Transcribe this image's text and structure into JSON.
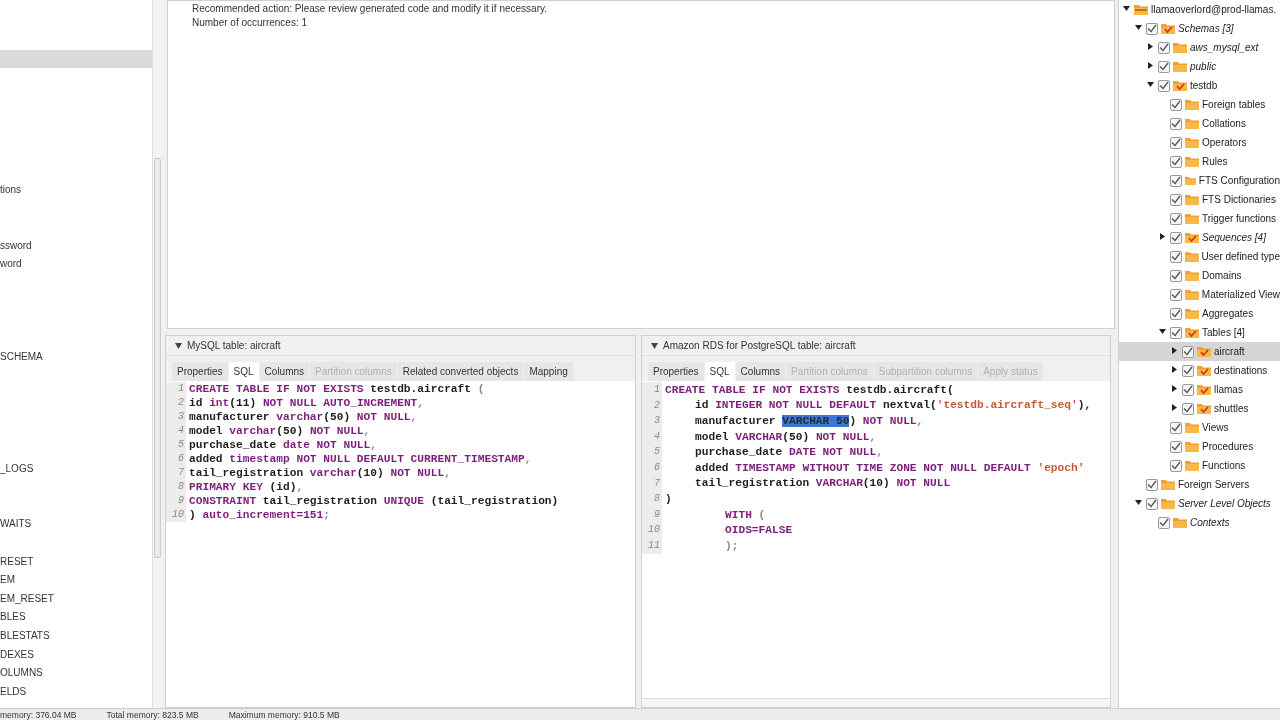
{
  "left_panel": {
    "items": [
      {
        "label": "tions"
      },
      {
        "label": "ssword"
      },
      {
        "label": "word"
      },
      {
        "label": "SCHEMA"
      },
      {
        "label": "_LOGS"
      },
      {
        "label": "WAITS"
      },
      {
        "label": "RESET"
      },
      {
        "label": "EM"
      },
      {
        "label": "EM_RESET"
      },
      {
        "label": "BLES"
      },
      {
        "label": "BLESTATS"
      },
      {
        "label": "DEXES"
      },
      {
        "label": "OLUMNS"
      },
      {
        "label": "ELDS"
      }
    ]
  },
  "message": {
    "lines": [
      "Recommended action: Please review generated code and modify it if necessary.",
      "Number of occurrences: 1"
    ]
  },
  "panels": [
    {
      "title": "MySQL table: aircraft",
      "expanded": true,
      "tabs": [
        {
          "label": "Properties",
          "selected": false,
          "disabled": false
        },
        {
          "label": "SQL",
          "selected": true,
          "disabled": false
        },
        {
          "label": "Columns",
          "selected": false,
          "disabled": false
        },
        {
          "label": "Partition columns",
          "selected": false,
          "disabled": true
        },
        {
          "label": "Related converted objects",
          "selected": false,
          "disabled": false
        },
        {
          "label": "Mapping",
          "selected": false,
          "disabled": false
        }
      ],
      "code": [
        {
          "number": "1",
          "kind": "top",
          "tokens": [
            {
              "text": "CREATE TABLE IF NOT EXISTS ",
              "kind": "keyword"
            },
            {
              "text": "testdb.aircraft ",
              "kind": "name"
            },
            {
              "text": "(",
              "kind": "punct"
            }
          ]
        },
        {
          "number": "2",
          "kind": "top",
          "tokens": [
            {
              "text": "id ",
              "kind": "name"
            },
            {
              "text": "int",
              "kind": "keyword"
            },
            {
              "text": "(11) ",
              "kind": "name"
            },
            {
              "text": "NOT NULL AUTO_INCREMENT",
              "kind": "keyword"
            },
            {
              "text": ",",
              "kind": "punct"
            }
          ]
        },
        {
          "number": "3",
          "kind": "top",
          "tokens": [
            {
              "text": "manufacturer ",
              "kind": "name"
            },
            {
              "text": "varchar",
              "kind": "keyword"
            },
            {
              "text": "(50) ",
              "kind": "name"
            },
            {
              "text": "NOT NULL",
              "kind": "keyword"
            },
            {
              "text": ",",
              "kind": "punct"
            }
          ]
        },
        {
          "number": "4",
          "kind": "top",
          "tokens": [
            {
              "text": "model ",
              "kind": "name"
            },
            {
              "text": "varchar",
              "kind": "keyword"
            },
            {
              "text": "(50) ",
              "kind": "name"
            },
            {
              "text": "NOT NULL",
              "kind": "keyword"
            },
            {
              "text": ",",
              "kind": "punct"
            }
          ]
        },
        {
          "number": "5",
          "kind": "top",
          "tokens": [
            {
              "text": "purchase_date ",
              "kind": "name"
            },
            {
              "text": "date NOT NULL",
              "kind": "keyword"
            },
            {
              "text": ",",
              "kind": "punct"
            }
          ]
        },
        {
          "number": "6",
          "kind": "top",
          "tokens": [
            {
              "text": "added ",
              "kind": "name"
            },
            {
              "text": "timestamp NOT NULL DEFAULT CURRENT_TIMESTAMP",
              "kind": "keyword"
            },
            {
              "text": ",",
              "kind": "punct"
            }
          ]
        },
        {
          "number": "7",
          "kind": "top",
          "tokens": [
            {
              "text": "tail_registration ",
              "kind": "name"
            },
            {
              "text": "varchar",
              "kind": "keyword"
            },
            {
              "text": "(10) ",
              "kind": "name"
            },
            {
              "text": "NOT NULL",
              "kind": "keyword"
            },
            {
              "text": ",",
              "kind": "punct"
            }
          ]
        },
        {
          "number": "8",
          "kind": "top",
          "tokens": [
            {
              "text": "PRIMARY KEY ",
              "kind": "keyword"
            },
            {
              "text": "(id)",
              "kind": "name"
            },
            {
              "text": ",",
              "kind": "punct"
            }
          ]
        },
        {
          "number": "9",
          "kind": "top",
          "tokens": [
            {
              "text": "CONSTRAINT ",
              "kind": "keyword"
            },
            {
              "text": "tail_registration ",
              "kind": "name"
            },
            {
              "text": "UNIQUE ",
              "kind": "keyword"
            },
            {
              "text": "(tail_registration)",
              "kind": "name"
            }
          ]
        },
        {
          "number": "10",
          "kind": "top",
          "tokens": [
            {
              "text": ") ",
              "kind": "name"
            },
            {
              "text": "auto_increment=151",
              "kind": "keyword"
            },
            {
              "text": ";",
              "kind": "punct"
            }
          ]
        }
      ]
    },
    {
      "title": "Amazon RDS for PostgreSQL table: aircraft",
      "expanded": true,
      "tabs": [
        {
          "label": "Properties",
          "selected": false,
          "disabled": false
        },
        {
          "label": "SQL",
          "selected": true,
          "disabled": false
        },
        {
          "label": "Columns",
          "selected": false,
          "disabled": false
        },
        {
          "label": "Partition columns",
          "selected": false,
          "disabled": true
        },
        {
          "label": "Subpartition columns",
          "selected": false,
          "disabled": true
        },
        {
          "label": "Apply status",
          "selected": false,
          "disabled": true
        }
      ],
      "code": [
        {
          "number": "1",
          "kind": "top",
          "tokens": [
            {
              "text": "CREATE TABLE IF NOT EXISTS ",
              "kind": "keyword"
            },
            {
              "text": "testdb.aircraft(",
              "kind": "name"
            }
          ]
        },
        {
          "number": "2",
          "kind": "body",
          "tokens": [
            {
              "text": "id ",
              "kind": "name"
            },
            {
              "text": "INTEGER NOT NULL DEFAULT ",
              "kind": "keyword"
            },
            {
              "text": "nextval(",
              "kind": "name"
            },
            {
              "text": "'testdb.aircraft_seq'",
              "kind": "string"
            },
            {
              "text": "),",
              "kind": "name"
            }
          ]
        },
        {
          "number": "3",
          "kind": "body",
          "tokens": [
            {
              "text": "manufacturer ",
              "kind": "name"
            },
            {
              "text": "VARCHAR 50",
              "kind": "selection"
            },
            {
              "text": ") ",
              "kind": "name"
            },
            {
              "text": "NOT NULL",
              "kind": "keyword"
            },
            {
              "text": ",",
              "kind": "punct"
            }
          ]
        },
        {
          "number": "4",
          "kind": "body",
          "tokens": [
            {
              "text": "model ",
              "kind": "name"
            },
            {
              "text": "VARCHAR",
              "kind": "keyword"
            },
            {
              "text": "(50) ",
              "kind": "name"
            },
            {
              "text": "NOT NULL",
              "kind": "keyword"
            },
            {
              "text": ",",
              "kind": "punct"
            }
          ]
        },
        {
          "number": "5",
          "kind": "body",
          "tokens": [
            {
              "text": "purchase_date ",
              "kind": "name"
            },
            {
              "text": "DATE NOT NULL",
              "kind": "keyword"
            },
            {
              "text": ",",
              "kind": "punct"
            }
          ]
        },
        {
          "number": "6",
          "kind": "body",
          "tokens": [
            {
              "text": "added ",
              "kind": "name"
            },
            {
              "text": "TIMESTAMP WITHOUT TIME ZONE NOT NULL DEFAULT ",
              "kind": "keyword"
            },
            {
              "text": "'epoch'",
              "kind": "string"
            }
          ]
        },
        {
          "number": "7",
          "kind": "body",
          "tokens": [
            {
              "text": "tail_registration ",
              "kind": "name"
            },
            {
              "text": "VARCHAR",
              "kind": "keyword"
            },
            {
              "text": "(10) ",
              "kind": "name"
            },
            {
              "text": "NOT NULL",
              "kind": "keyword"
            }
          ]
        },
        {
          "number": "8",
          "kind": "top",
          "tokens": [
            {
              "text": ")",
              "kind": "name"
            }
          ]
        },
        {
          "number": "9",
          "kind": "clause",
          "tokens": [
            {
              "text": "WITH ",
              "kind": "keyword"
            },
            {
              "text": "(",
              "kind": "punct"
            }
          ]
        },
        {
          "number": "10",
          "kind": "clause",
          "tokens": [
            {
              "text": "OIDS=FALSE",
              "kind": "keyword"
            }
          ]
        },
        {
          "number": "11",
          "kind": "clause",
          "tokens": [
            {
              "text": ");",
              "kind": "punct"
            }
          ]
        }
      ]
    }
  ],
  "tree": {
    "root": {
      "label": "llamaoverlord@prod-llamas.",
      "kind": "server",
      "italic": false,
      "selected": false,
      "expanded": true,
      "children": [
        {
          "label": "Schemas [3]",
          "kind": "converted",
          "italic": true,
          "checked": true,
          "selected": false,
          "expanded": true,
          "children": [
            {
              "label": "aws_mysql_ext",
              "kind": "folder",
              "italic": true,
              "checked": true,
              "selected": false,
              "expanded": false
            },
            {
              "label": "public",
              "kind": "folder",
              "italic": true,
              "checked": true,
              "selected": false,
              "expanded": false
            },
            {
              "label": "testdb",
              "kind": "converted",
              "italic": false,
              "checked": true,
              "selected": false,
              "expanded": true,
              "children": [
                {
                  "label": "Foreign tables",
                  "kind": "folder",
                  "italic": false,
                  "checked": true,
                  "selected": false
                },
                {
                  "label": "Collations",
                  "kind": "folder",
                  "italic": false,
                  "checked": true,
                  "selected": false
                },
                {
                  "label": "Operators",
                  "kind": "folder",
                  "italic": false,
                  "checked": true,
                  "selected": false
                },
                {
                  "label": "Rules",
                  "kind": "folder",
                  "italic": false,
                  "checked": true,
                  "selected": false
                },
                {
                  "label": "FTS Configuration",
                  "kind": "folder",
                  "italic": false,
                  "checked": true,
                  "selected": false
                },
                {
                  "label": "FTS Dictionaries",
                  "kind": "folder",
                  "italic": false,
                  "checked": true,
                  "selected": false
                },
                {
                  "label": "Trigger functions",
                  "kind": "folder",
                  "italic": false,
                  "checked": true,
                  "selected": false
                },
                {
                  "label": "Sequences [4]",
                  "kind": "converted",
                  "italic": true,
                  "checked": true,
                  "selected": false,
                  "expanded": false
                },
                {
                  "label": "User defined type",
                  "kind": "folder",
                  "italic": false,
                  "checked": true,
                  "selected": false
                },
                {
                  "label": "Domains",
                  "kind": "folder",
                  "italic": false,
                  "checked": true,
                  "selected": false
                },
                {
                  "label": "Materialized View",
                  "kind": "folder",
                  "italic": false,
                  "checked": true,
                  "selected": false
                },
                {
                  "label": "Aggregates",
                  "kind": "folder",
                  "italic": false,
                  "checked": true,
                  "selected": false
                },
                {
                  "label": "Tables [4]",
                  "kind": "converted",
                  "italic": false,
                  "checked": true,
                  "selected": false,
                  "expanded": true,
                  "children": [
                    {
                      "label": "aircraft",
                      "kind": "converted",
                      "italic": false,
                      "checked": true,
                      "selected": true,
                      "expanded": false
                    },
                    {
                      "label": "destinations",
                      "kind": "converted",
                      "italic": false,
                      "checked": true,
                      "selected": false,
                      "expanded": false
                    },
                    {
                      "label": "llamas",
                      "kind": "converted",
                      "italic": false,
                      "checked": true,
                      "selected": false,
                      "expanded": false
                    },
                    {
                      "label": "shuttles",
                      "kind": "converted",
                      "italic": false,
                      "checked": true,
                      "selected": false,
                      "expanded": false
                    }
                  ]
                },
                {
                  "label": "Views",
                  "kind": "folder",
                  "italic": false,
                  "checked": true,
                  "selected": false
                },
                {
                  "label": "Procedures",
                  "kind": "folder",
                  "italic": false,
                  "checked": true,
                  "selected": false
                },
                {
                  "label": "Functions",
                  "kind": "folder",
                  "italic": false,
                  "checked": true,
                  "selected": false
                }
              ]
            }
          ]
        },
        {
          "label": "Foreign Servers",
          "kind": "folder",
          "italic": false,
          "checked": true,
          "selected": false
        },
        {
          "label": "Server Level Objects",
          "kind": "folder",
          "italic": true,
          "checked": true,
          "selected": false,
          "expanded": true,
          "children": [
            {
              "label": "Contexts",
              "kind": "folder",
              "italic": true,
              "checked": true,
              "selected": false
            }
          ]
        }
      ]
    }
  },
  "status_bar": [
    "memory: 376.04 MB",
    "Total memory: 823.5 MB",
    "Maximum memory: 910.5 MB"
  ]
}
